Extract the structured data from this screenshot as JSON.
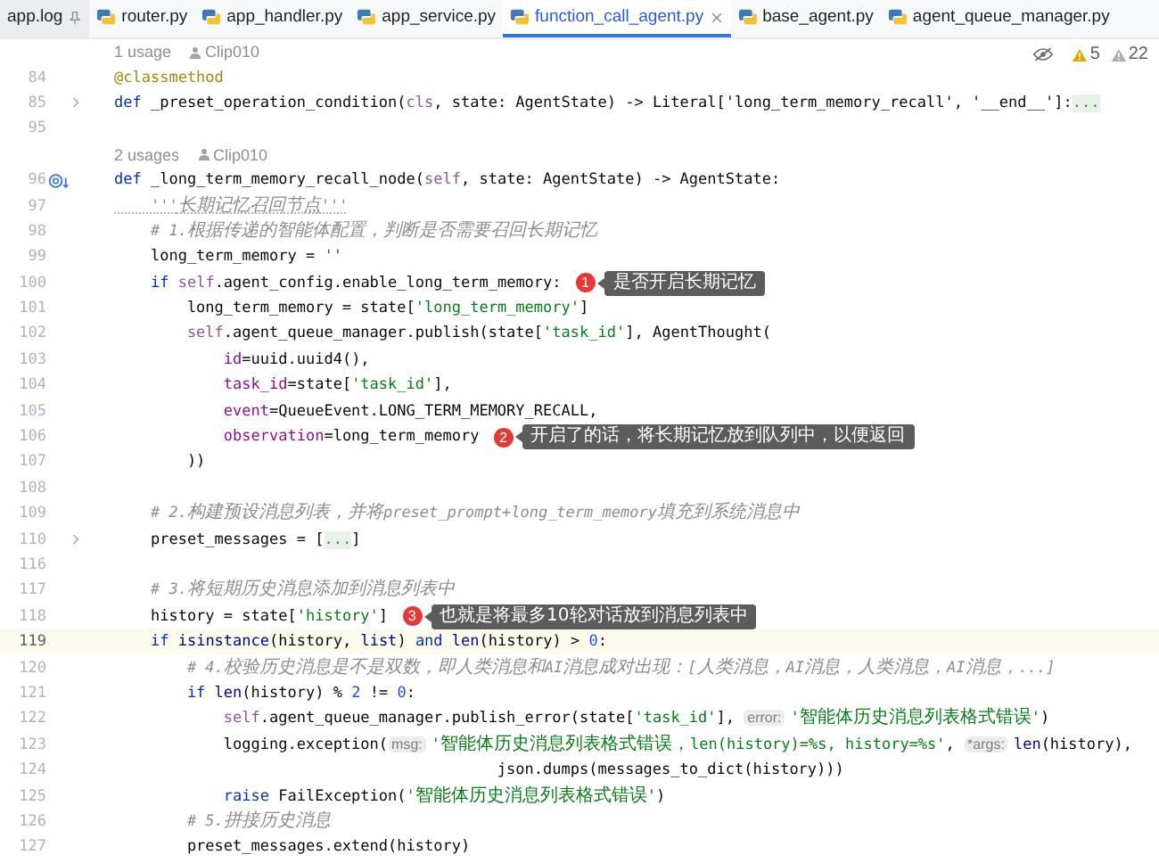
{
  "tabs": [
    {
      "label": "app.log",
      "kind": "log",
      "pinned": true,
      "selected": false
    },
    {
      "label": "router.py",
      "kind": "python",
      "pinned": false,
      "selected": false
    },
    {
      "label": "app_handler.py",
      "kind": "python",
      "pinned": false,
      "selected": false
    },
    {
      "label": "app_service.py",
      "kind": "python",
      "pinned": false,
      "selected": false
    },
    {
      "label": "function_call_agent.py",
      "kind": "python",
      "pinned": false,
      "selected": true
    },
    {
      "label": "base_agent.py",
      "kind": "python",
      "pinned": false,
      "selected": false
    },
    {
      "label": "agent_queue_manager.py",
      "kind": "python",
      "pinned": false,
      "selected": false
    }
  ],
  "inspections": [
    {
      "kind": "warning",
      "count": "5"
    },
    {
      "kind": "weak_warning",
      "count": "22"
    }
  ],
  "rows": [
    {
      "kind": "usage",
      "usages": "1 usage",
      "author": "Clip010"
    },
    {
      "kind": "code",
      "number": "84",
      "current": false,
      "foldable": false,
      "tokens": [
        {
          "kind": "deco",
          "text": "@classmethod"
        }
      ]
    },
    {
      "kind": "code",
      "number": "85",
      "current": false,
      "foldable": true,
      "tokens": [
        {
          "kind": "kw",
          "text": "def"
        },
        {
          "kind": "plain",
          "text": " _preset_operation_condition("
        },
        {
          "kind": "self",
          "text": "cls"
        },
        {
          "kind": "plain",
          "text": ", state: AgentState) -> Literal['long_term_memory_recall', '__end__']:"
        },
        {
          "kind": "fold",
          "text": "..."
        }
      ]
    },
    {
      "kind": "code",
      "number": "95",
      "current": false,
      "foldable": false,
      "tokens": []
    },
    {
      "kind": "usage",
      "usages": "2 usages",
      "author": "Clip010"
    },
    {
      "kind": "code",
      "number": "96",
      "current": false,
      "foldable": false,
      "gutter_marker": {
        "kind": "override"
      },
      "tokens": [
        {
          "kind": "kw",
          "text": "def"
        },
        {
          "kind": "plain",
          "text": " _long_term_memory_recall_node("
        },
        {
          "kind": "self",
          "text": "self"
        },
        {
          "kind": "plain",
          "text": ", state: AgentState) -> AgentState:"
        }
      ]
    },
    {
      "kind": "code",
      "number": "97",
      "current": false,
      "foldable": false,
      "tokens": [
        {
          "kind": "doc",
          "text": "    '''长期记忆召回节点'''"
        }
      ]
    },
    {
      "kind": "code",
      "number": "98",
      "current": false,
      "foldable": false,
      "tokens": [
        {
          "kind": "comment",
          "text": "    # 1.根据传递的智能体配置，判断是否需要召回长期记忆"
        }
      ]
    },
    {
      "kind": "code",
      "number": "99",
      "current": false,
      "foldable": false,
      "tokens": [
        {
          "kind": "plain",
          "text": "    long_term_memory = "
        },
        {
          "kind": "str",
          "text": "''"
        }
      ]
    },
    {
      "kind": "code",
      "number": "100",
      "current": false,
      "foldable": false,
      "callout": {
        "number": "1",
        "text": "是否开启长期记忆"
      },
      "tokens": [
        {
          "kind": "kw",
          "text": "    if"
        },
        {
          "kind": "self",
          "text": " self"
        },
        {
          "kind": "plain",
          "text": ".agent_config.enable_long_term_memory:"
        }
      ]
    },
    {
      "kind": "code",
      "number": "101",
      "current": false,
      "foldable": false,
      "tokens": [
        {
          "kind": "plain",
          "text": "        long_term_memory = state["
        },
        {
          "kind": "str",
          "text": "'long_term_memory'"
        },
        {
          "kind": "plain",
          "text": "]"
        }
      ]
    },
    {
      "kind": "code",
      "number": "102",
      "current": false,
      "foldable": false,
      "tokens": [
        {
          "kind": "self",
          "text": "        self"
        },
        {
          "kind": "plain",
          "text": ".agent_queue_manager.publish(state["
        },
        {
          "kind": "str",
          "text": "'task_id'"
        },
        {
          "kind": "plain",
          "text": "], AgentThought("
        }
      ]
    },
    {
      "kind": "code",
      "number": "103",
      "current": false,
      "foldable": false,
      "tokens": [
        {
          "kind": "param",
          "text": "            id"
        },
        {
          "kind": "plain",
          "text": "=uuid.uuid4(),"
        }
      ]
    },
    {
      "kind": "code",
      "number": "104",
      "current": false,
      "foldable": false,
      "tokens": [
        {
          "kind": "param",
          "text": "            task_id"
        },
        {
          "kind": "plain",
          "text": "=state["
        },
        {
          "kind": "str",
          "text": "'task_id'"
        },
        {
          "kind": "plain",
          "text": "],"
        }
      ]
    },
    {
      "kind": "code",
      "number": "105",
      "current": false,
      "foldable": false,
      "tokens": [
        {
          "kind": "param",
          "text": "            event"
        },
        {
          "kind": "plain",
          "text": "=QueueEvent.LONG_TERM_MEMORY_RECALL,"
        }
      ]
    },
    {
      "kind": "code",
      "number": "106",
      "current": false,
      "foldable": false,
      "callout": {
        "number": "2",
        "text": "开启了的话，将长期记忆放到队列中，以便返回"
      },
      "tokens": [
        {
          "kind": "param",
          "text": "            observation"
        },
        {
          "kind": "plain",
          "text": "=long_term_memory"
        }
      ]
    },
    {
      "kind": "code",
      "number": "107",
      "current": false,
      "foldable": false,
      "tokens": [
        {
          "kind": "plain",
          "text": "        ))"
        }
      ]
    },
    {
      "kind": "code",
      "number": "108",
      "current": false,
      "foldable": false,
      "tokens": []
    },
    {
      "kind": "code",
      "number": "109",
      "current": false,
      "foldable": false,
      "tokens": [
        {
          "kind": "comment",
          "text": "    # 2.构建预设消息列表，并将preset_prompt+long_term_memory填充到系统消息中"
        }
      ]
    },
    {
      "kind": "code",
      "number": "110",
      "current": false,
      "foldable": true,
      "tokens": [
        {
          "kind": "plain",
          "text": "    preset_messages = ["
        },
        {
          "kind": "fold",
          "text": "..."
        },
        {
          "kind": "plain",
          "text": "]"
        }
      ]
    },
    {
      "kind": "code",
      "number": "116",
      "current": false,
      "foldable": false,
      "tokens": []
    },
    {
      "kind": "code",
      "number": "117",
      "current": false,
      "foldable": false,
      "tokens": [
        {
          "kind": "comment",
          "text": "    # 3.将短期历史消息添加到消息列表中"
        }
      ]
    },
    {
      "kind": "code",
      "number": "118",
      "current": false,
      "foldable": false,
      "callout": {
        "number": "3",
        "text": "也就是将最多10轮对话放到消息列表中"
      },
      "tokens": [
        {
          "kind": "plain",
          "text": "    history = state["
        },
        {
          "kind": "str",
          "text": "'history'"
        },
        {
          "kind": "plain",
          "text": "]"
        }
      ]
    },
    {
      "kind": "code",
      "number": "119",
      "current": true,
      "foldable": false,
      "tokens": [
        {
          "kind": "kw",
          "text": "    if"
        },
        {
          "kind": "builtin",
          "text": " isinstance"
        },
        {
          "kind": "plain",
          "text": "(history, "
        },
        {
          "kind": "builtin",
          "text": "list"
        },
        {
          "kind": "plain",
          "text": ") "
        },
        {
          "kind": "kw",
          "text": "and"
        },
        {
          "kind": "builtin",
          "text": " len"
        },
        {
          "kind": "plain",
          "text": "(history) > "
        },
        {
          "kind": "num",
          "text": "0"
        },
        {
          "kind": "plain",
          "text": ":"
        }
      ]
    },
    {
      "kind": "code",
      "number": "120",
      "current": false,
      "foldable": false,
      "tokens": [
        {
          "kind": "comment",
          "text": "        # 4.校验历史消息是不是双数，即人类消息和AI消息成对出现：[人类消息，AI消息，人类消息，AI消息，...]"
        }
      ]
    },
    {
      "kind": "code",
      "number": "121",
      "current": false,
      "foldable": false,
      "tokens": [
        {
          "kind": "kw",
          "text": "        if"
        },
        {
          "kind": "builtin",
          "text": " len"
        },
        {
          "kind": "plain",
          "text": "(history) % "
        },
        {
          "kind": "num",
          "text": "2"
        },
        {
          "kind": "plain",
          "text": " != "
        },
        {
          "kind": "num",
          "text": "0"
        },
        {
          "kind": "plain",
          "text": ":"
        }
      ]
    },
    {
      "kind": "code",
      "number": "122",
      "current": false,
      "foldable": false,
      "tokens": [
        {
          "kind": "self",
          "text": "            self"
        },
        {
          "kind": "plain",
          "text": ".agent_queue_manager.publish_error(state["
        },
        {
          "kind": "str",
          "text": "'task_id'"
        },
        {
          "kind": "plain",
          "text": "], "
        },
        {
          "kind": "hint",
          "text": "error:"
        },
        {
          "kind": "str",
          "text": "'智能体历史消息列表格式错误'"
        },
        {
          "kind": "plain",
          "text": ")"
        }
      ]
    },
    {
      "kind": "code",
      "number": "123",
      "current": false,
      "foldable": false,
      "tokens": [
        {
          "kind": "plain",
          "text": "            logging.exception("
        },
        {
          "kind": "hint",
          "text": "msg:"
        },
        {
          "kind": "str",
          "text": "'智能体历史消息列表格式错误，len(history)=%s, history=%s'"
        },
        {
          "kind": "plain",
          "text": ", "
        },
        {
          "kind": "hint",
          "text": "*args:"
        },
        {
          "kind": "builtin",
          "text": "len"
        },
        {
          "kind": "plain",
          "text": "(history),"
        }
      ]
    },
    {
      "kind": "code",
      "number": "124",
      "current": false,
      "foldable": false,
      "tokens": [
        {
          "kind": "plain",
          "text": "                                          json.dumps(messages_to_dict(history)))"
        }
      ]
    },
    {
      "kind": "code",
      "number": "125",
      "current": false,
      "foldable": false,
      "tokens": [
        {
          "kind": "kw",
          "text": "            raise"
        },
        {
          "kind": "plain",
          "text": " FailException("
        },
        {
          "kind": "str",
          "text": "'智能体历史消息列表格式错误'"
        },
        {
          "kind": "plain",
          "text": ")"
        }
      ]
    },
    {
      "kind": "code",
      "number": "126",
      "current": false,
      "foldable": false,
      "tokens": [
        {
          "kind": "comment",
          "text": "        # 5.拼接历史消息"
        }
      ]
    },
    {
      "kind": "code",
      "number": "127",
      "current": false,
      "foldable": false,
      "tokens": [
        {
          "kind": "plain",
          "text": "        preset_messages.extend(history)"
        }
      ]
    }
  ]
}
